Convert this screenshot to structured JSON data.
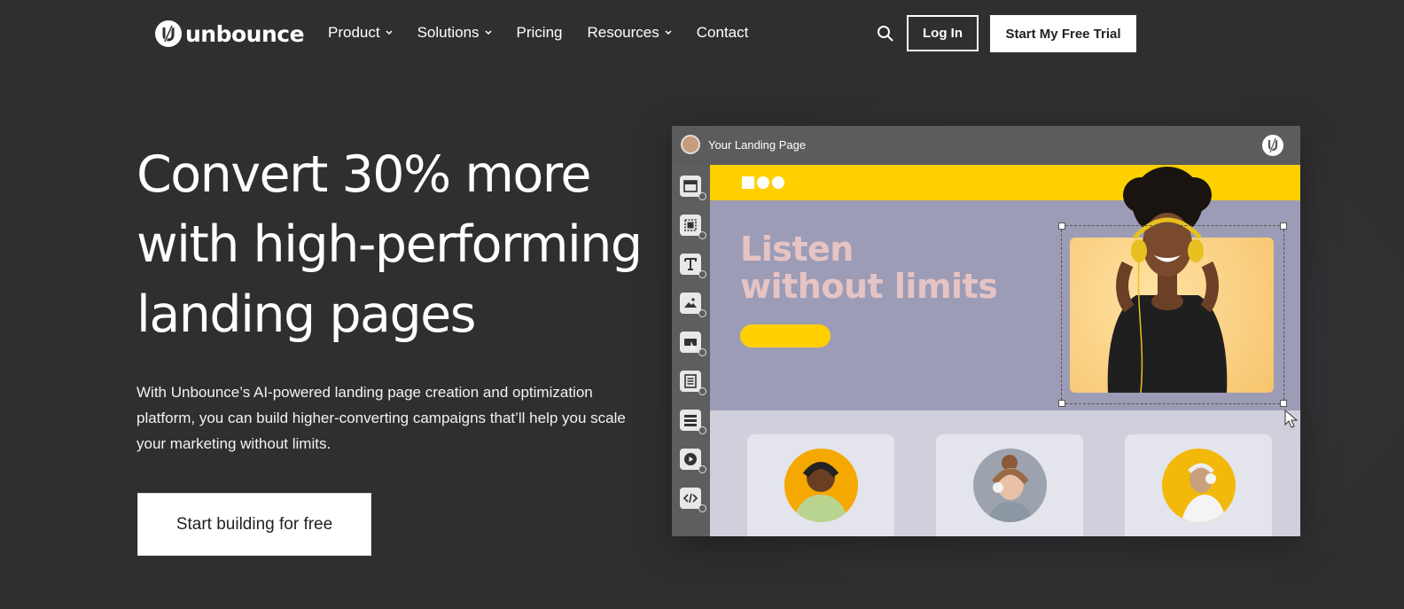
{
  "header": {
    "logo_text": "unbounce",
    "nav": [
      {
        "label": "Product",
        "has_dropdown": true
      },
      {
        "label": "Solutions",
        "has_dropdown": true
      },
      {
        "label": "Pricing",
        "has_dropdown": false
      },
      {
        "label": "Resources",
        "has_dropdown": true
      },
      {
        "label": "Contact",
        "has_dropdown": false
      }
    ],
    "search_icon": "search-icon",
    "login_label": "Log In",
    "trial_label": "Start My Free Trial"
  },
  "hero": {
    "headline": "Convert 30% more with high-performing landing pages",
    "subtext": "With Unbounce’s AI-powered landing page creation and optimization platform, you can build higher-converting campaigns that’ll help you scale your marketing without limits.",
    "cta_label": "Start building for free"
  },
  "editor": {
    "title": "Your Landing Page",
    "tools": [
      "section-icon",
      "box-icon",
      "text-icon",
      "image-icon",
      "button-icon",
      "form-icon",
      "list-icon",
      "video-icon",
      "code-icon"
    ],
    "canvas": {
      "headline_line1": "Listen",
      "headline_line2": "without limits"
    }
  },
  "colors": {
    "background": "#2f2f2f",
    "accent_yellow": "#ffd000",
    "hero_band": "#9d9cb6",
    "hero_text": "#e6c4c4"
  }
}
